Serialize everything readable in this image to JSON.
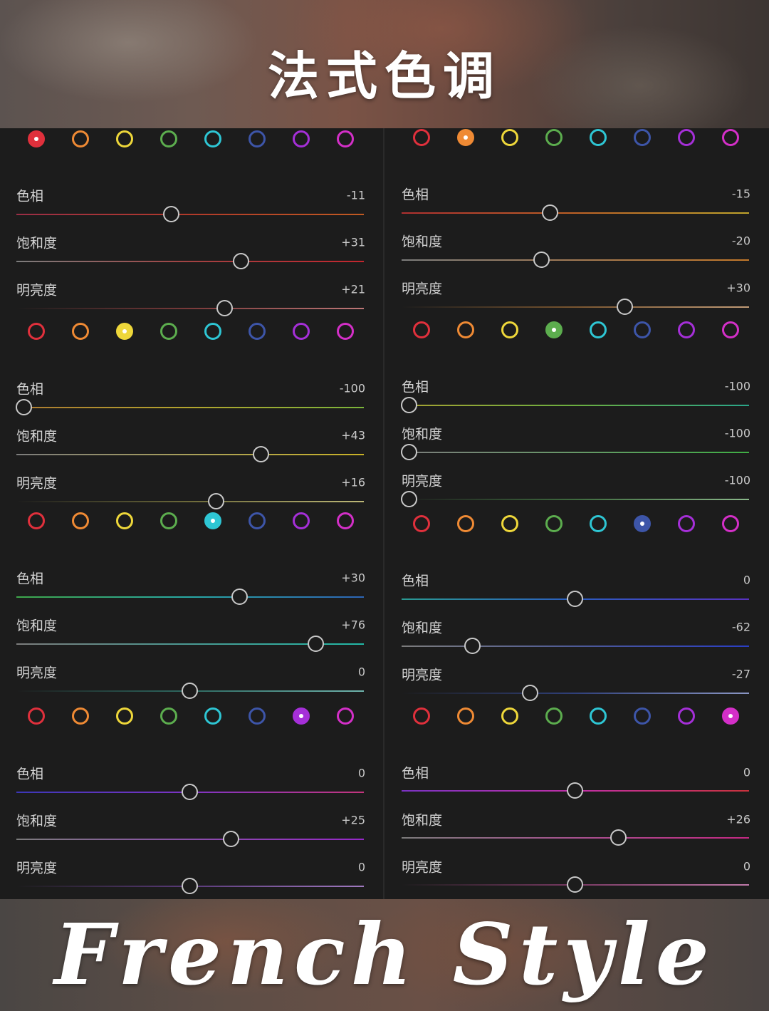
{
  "title": "法式色调",
  "subtitle": "French Style",
  "swatch_colors": [
    "#e0303c",
    "#ef8a34",
    "#eed73a",
    "#5cad4e",
    "#2ec6d4",
    "#3d55a8",
    "#a52fd8",
    "#d42fc8"
  ],
  "panels": [
    {
      "column": "left",
      "sections": [
        {
          "active_color": 0,
          "rows": [
            {
              "label": "色相",
              "value": "-11",
              "position": -11,
              "gradient": [
                "#9a2e46",
                "#b13a2a",
                "#c05a22"
              ]
            },
            {
              "label": "饱和度",
              "value": "+31",
              "position": 31,
              "gradient": [
                "#7c7c7c",
                "#a24242",
                "#c2262e"
              ]
            },
            {
              "label": "明亮度",
              "value": "+21",
              "position": 21,
              "gradient": [
                "#1c1c1c",
                "#7a3a3a",
                "#bd7777"
              ]
            }
          ]
        },
        {
          "active_color": 2,
          "rows": [
            {
              "label": "色相",
              "value": "-100",
              "position": -100,
              "gradient": [
                "#ad7a30",
                "#b3a52e",
                "#7ab43a"
              ]
            },
            {
              "label": "饱和度",
              "value": "+43",
              "position": 43,
              "gradient": [
                "#7c7c7c",
                "#a9a05a",
                "#c8b126"
              ]
            },
            {
              "label": "明亮度",
              "value": "+16",
              "position": 16,
              "gradient": [
                "#1c1c1c",
                "#6d6a3a",
                "#bdb877"
              ]
            }
          ]
        },
        {
          "active_color": 4,
          "rows": [
            {
              "label": "色相",
              "value": "+30",
              "position": 30,
              "gradient": [
                "#3ea84a",
                "#28a9a6",
                "#2d65b7"
              ]
            },
            {
              "label": "饱和度",
              "value": "+76",
              "position": 76,
              "gradient": [
                "#7c7c7c",
                "#4a9a93",
                "#22b8a6"
              ]
            },
            {
              "label": "明亮度",
              "value": "0",
              "position": 0,
              "gradient": [
                "#1c1c1c",
                "#2e6a62",
                "#6fb4ad"
              ]
            }
          ]
        },
        {
          "active_color": 6,
          "rows": [
            {
              "label": "色相",
              "value": "0",
              "position": 0,
              "gradient": [
                "#3b36b7",
                "#7e34c4",
                "#c2357c"
              ]
            },
            {
              "label": "饱和度",
              "value": "+25",
              "position": 25,
              "gradient": [
                "#7c7c7c",
                "#8a4eaa",
                "#9528c7"
              ]
            },
            {
              "label": "明亮度",
              "value": "0",
              "position": 0,
              "gradient": [
                "#1c1c1c",
                "#5a3a7a",
                "#a07ac0"
              ]
            }
          ]
        }
      ]
    },
    {
      "column": "right",
      "sections": [
        {
          "active_color": 1,
          "rows": [
            {
              "label": "色相",
              "value": "-15",
              "position": -15,
              "gradient": [
                "#b03030",
                "#bf6226",
                "#c0a52c"
              ]
            },
            {
              "label": "饱和度",
              "value": "-20",
              "position": -20,
              "gradient": [
                "#7c7c7c",
                "#a27a54",
                "#c4792a"
              ]
            },
            {
              "label": "明亮度",
              "value": "+30",
              "position": 30,
              "gradient": [
                "#1c1c1c",
                "#7a5630",
                "#c29c77"
              ]
            }
          ]
        },
        {
          "active_color": 3,
          "rows": [
            {
              "label": "色相",
              "value": "-100",
              "position": -100,
              "gradient": [
                "#a7a232",
                "#6bae40",
                "#2aa68a"
              ]
            },
            {
              "label": "饱和度",
              "value": "-100",
              "position": -100,
              "gradient": [
                "#7c7c7c",
                "#679868",
                "#3fae44"
              ]
            },
            {
              "label": "明亮度",
              "value": "-100",
              "position": -100,
              "gradient": [
                "#1c1c1c",
                "#3e6a3e",
                "#8ab88a"
              ]
            }
          ]
        },
        {
          "active_color": 5,
          "rows": [
            {
              "label": "色相",
              "value": "0",
              "position": 0,
              "gradient": [
                "#2a9a92",
                "#2b5cbf",
                "#5832c0"
              ]
            },
            {
              "label": "饱和度",
              "value": "-62",
              "position": -62,
              "gradient": [
                "#7c7c7c",
                "#4e5a96",
                "#2a3ec4"
              ]
            },
            {
              "label": "明亮度",
              "value": "-27",
              "position": -27,
              "gradient": [
                "#1c1c1c",
                "#30407a",
                "#8a96c4"
              ]
            }
          ]
        },
        {
          "active_color": 7,
          "rows": [
            {
              "label": "色相",
              "value": "0",
              "position": 0,
              "gradient": [
                "#7a32c2",
                "#c030a6",
                "#c8323c"
              ]
            },
            {
              "label": "饱和度",
              "value": "+26",
              "position": 26,
              "gradient": [
                "#7c7c7c",
                "#a85290",
                "#c52883"
              ]
            },
            {
              "label": "明亮度",
              "value": "0",
              "position": 0,
              "gradient": [
                "#1c1c1c",
                "#7a3a64",
                "#c07aaa"
              ]
            }
          ]
        }
      ]
    }
  ]
}
